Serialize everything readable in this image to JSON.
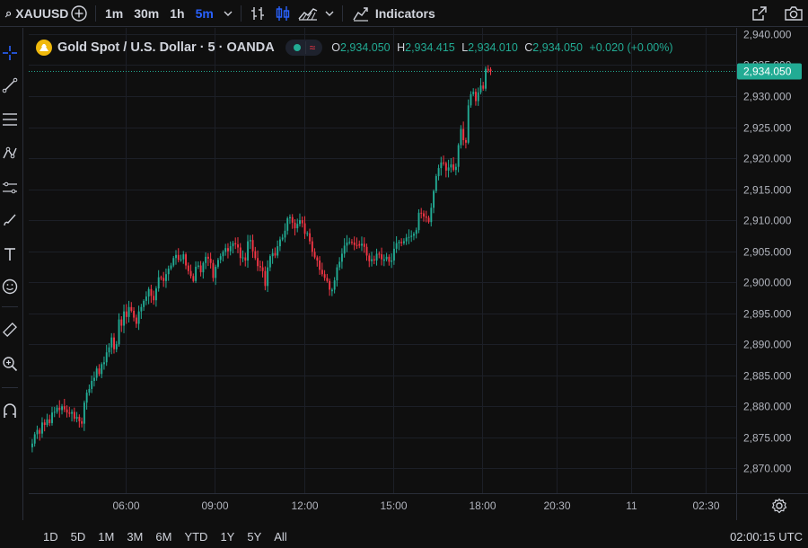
{
  "toolbar": {
    "symbol": "XAUUSD",
    "intervals": [
      "1m",
      "30m",
      "1h",
      "5m"
    ],
    "active_interval": "5m",
    "indicators_label": "Indicators"
  },
  "legend": {
    "title": "Gold Spot / U.S. Dollar · 5 · OANDA",
    "o_label": "O",
    "o_value": "2,934.050",
    "h_label": "H",
    "h_value": "2,934.415",
    "l_label": "L",
    "l_value": "2,934.010",
    "c_label": "C",
    "c_value": "2,934.050",
    "change": "+0.020 (+0.00%)"
  },
  "colors": {
    "up": "#22ab94",
    "down": "#f23645",
    "accent": "#2962ff",
    "price_label_bg": "#22ab94"
  },
  "bottombar": {
    "ranges": [
      "1D",
      "5D",
      "1M",
      "3M",
      "6M",
      "YTD",
      "1Y",
      "5Y",
      "All"
    ],
    "clock": "02:00:15 UTC"
  },
  "chart_data": {
    "type": "candlestick",
    "symbol": "XAUUSD",
    "timeframe": "5",
    "grid": true,
    "ylim": [
      2866,
      2941
    ],
    "y_ticks": [
      "2,870.000",
      "2,875.000",
      "2,880.000",
      "2,885.000",
      "2,890.000",
      "2,895.000",
      "2,900.000",
      "2,905.000",
      "2,910.000",
      "2,915.000",
      "2,920.000",
      "2,925.000",
      "2,930.000",
      "2,935.000",
      "2,940.000"
    ],
    "x_ticks": [
      {
        "label": "06:00",
        "i": 38
      },
      {
        "label": "09:00",
        "i": 74
      },
      {
        "label": "12:00",
        "i": 110
      },
      {
        "label": "15:00",
        "i": 146
      },
      {
        "label": "18:00",
        "i": 182
      },
      {
        "label": "20:30",
        "i": 212
      },
      {
        "label": "11",
        "i": 242
      },
      {
        "label": "02:30",
        "i": 272
      }
    ],
    "last_price": "2,934.050",
    "last_value": 2934.05,
    "closes": [
      2874.0,
      2875.5,
      2876.2,
      2875.6,
      2877.4,
      2877.0,
      2877.9,
      2877.3,
      2879.0,
      2879.1,
      2879.8,
      2879.4,
      2880.0,
      2879.5,
      2879.0,
      2878.8,
      2879.1,
      2878.0,
      2878.3,
      2877.6,
      2877.2,
      2880.6,
      2882.2,
      2882.8,
      2884.1,
      2884.6,
      2886.1,
      2885.2,
      2886.8,
      2887.1,
      2888.7,
      2889.5,
      2891.1,
      2889.2,
      2890.0,
      2894.0,
      2893.0,
      2895.3,
      2894.4,
      2896.0,
      2895.4,
      2894.3,
      2893.3,
      2895.3,
      2896.0,
      2897.0,
      2897.7,
      2898.9,
      2897.8,
      2897.1,
      2899.0,
      2900.8,
      2900.7,
      2900.2,
      2901.3,
      2902.2,
      2902.7,
      2903.9,
      2904.4,
      2903.6,
      2903.7,
      2904.5,
      2902.7,
      2901.8,
      2901.0,
      2900.2,
      2902.5,
      2902.7,
      2901.6,
      2903.1,
      2904.1,
      2903.8,
      2903.1,
      2900.7,
      2902.5,
      2903.6,
      2904.2,
      2904.9,
      2905.5,
      2905.0,
      2905.8,
      2906.3,
      2906.1,
      2905.6,
      2903.9,
      2904.0,
      2903.5,
      2906.6,
      2906.8,
      2905.0,
      2903.9,
      2902.6,
      2902.4,
      2901.8,
      2899.4,
      2902.4,
      2904.2,
      2904.7,
      2904.3,
      2905.8,
      2906.9,
      2907.2,
      2908.3,
      2910.3,
      2910.5,
      2909.6,
      2908.7,
      2909.4,
      2910.0,
      2909.5,
      2907.8,
      2907.9,
      2906.6,
      2904.9,
      2904.0,
      2903.5,
      2902.0,
      2901.3,
      2900.7,
      2900.2,
      2898.8,
      2898.8,
      2900.3,
      2902.4,
      2903.3,
      2904.6,
      2905.9,
      2906.4,
      2906.5,
      2906.4,
      2906.0,
      2905.9,
      2905.9,
      2906.2,
      2905.7,
      2904.3,
      2903.4,
      2903.7,
      2903.5,
      2904.6,
      2904.5,
      2903.7,
      2903.7,
      2904.1,
      2903.3,
      2903.5,
      2905.4,
      2906.3,
      2906.5,
      2906.3,
      2906.6,
      2907.2,
      2907.3,
      2907.5,
      2907.8,
      2908.4,
      2911.2,
      2911.1,
      2910.6,
      2910.4,
      2909.7,
      2912.0,
      2914.7,
      2917.1,
      2918.4,
      2919.3,
      2919.2,
      2918.0,
      2918.5,
      2919.0,
      2918.1,
      2918.6,
      2922.1,
      2924.7,
      2922.9,
      2922.5,
      2928.5,
      2930.3,
      2930.7,
      2929.2,
      2930.6,
      2931.7,
      2931.2,
      2934.4,
      2934.1,
      2934.05
    ]
  }
}
